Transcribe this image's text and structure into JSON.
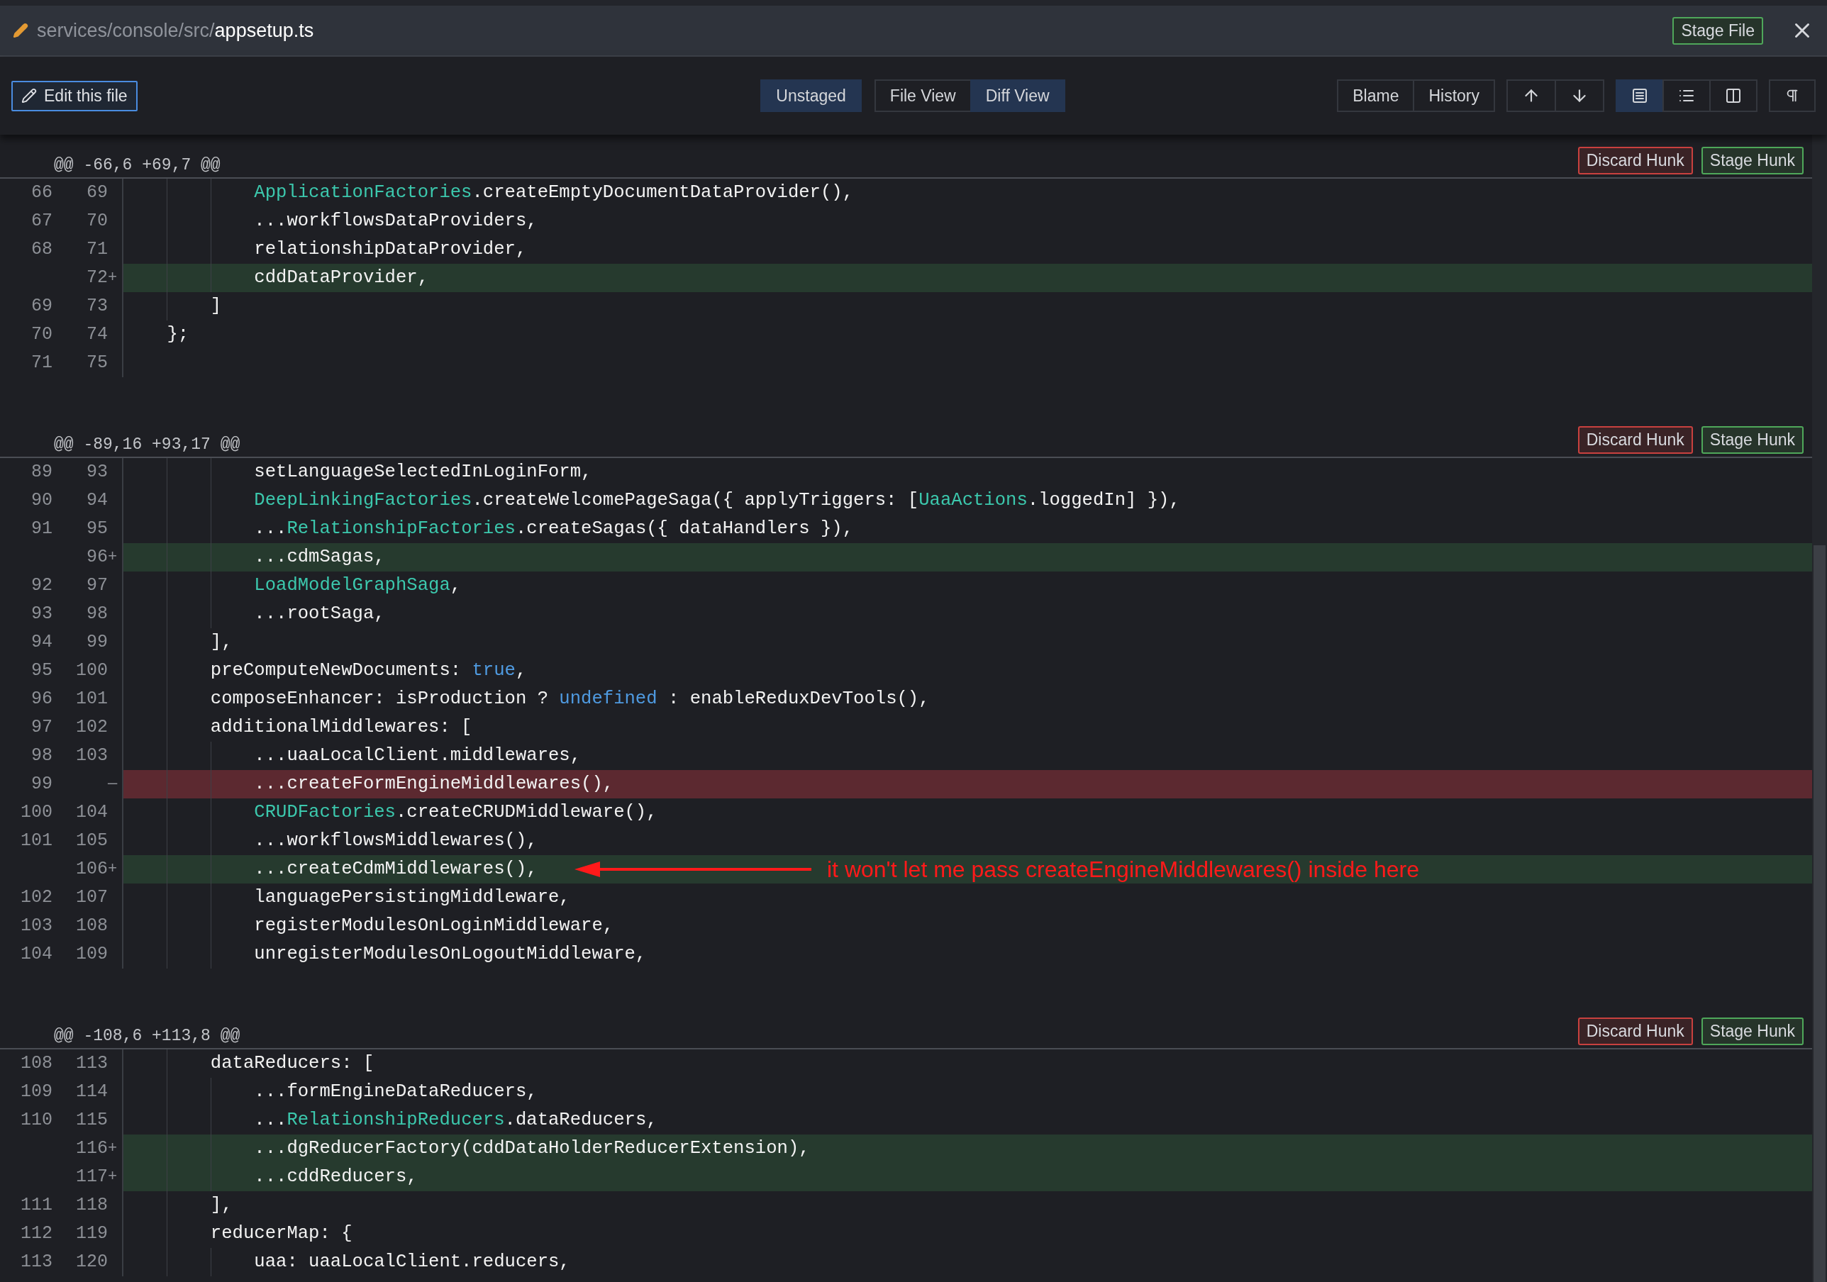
{
  "title_bar": {
    "path": "services/console/src/",
    "file": "appsetup.ts",
    "stage_button": "Stage File"
  },
  "toolbar": {
    "edit_button": "Edit this file",
    "stage_selector": "Unstaged",
    "views": [
      {
        "label": "File View",
        "selected": false
      },
      {
        "label": "Diff View",
        "selected": true
      }
    ],
    "history_buttons": [
      "Blame",
      "History"
    ],
    "layouts": [
      {
        "kind": "unified",
        "selected": true
      },
      {
        "kind": "list",
        "selected": false
      },
      {
        "kind": "split",
        "selected": false
      }
    ]
  },
  "hunks": [
    {
      "header": "@@ -66,6 +69,7 @@",
      "discard_button": "Discard Hunk",
      "stage_button": "Stage Hunk",
      "lines": [
        {
          "old": "66",
          "new": "69",
          "kind": "context",
          "tokens": [
            {
              "text": "            ApplicationFactories",
              "kind": "type"
            },
            {
              "text": ".createEmptyDocumentDataProvider(),"
            }
          ]
        },
        {
          "old": "67",
          "new": "70",
          "kind": "context",
          "tokens": [
            {
              "text": "            ...workflowsDataProviders,"
            }
          ]
        },
        {
          "old": "68",
          "new": "71",
          "kind": "context",
          "tokens": [
            {
              "text": "            relationshipDataProvider,"
            }
          ]
        },
        {
          "new": "72",
          "kind": "add",
          "sign": "+",
          "tokens": [
            {
              "text": "            cddDataProvider,"
            }
          ]
        },
        {
          "old": "69",
          "new": "73",
          "kind": "context",
          "tokens": [
            {
              "text": "        ]"
            }
          ]
        },
        {
          "old": "70",
          "new": "74",
          "kind": "context",
          "tokens": [
            {
              "text": "    };"
            }
          ]
        },
        {
          "old": "71",
          "new": "75",
          "kind": "context"
        }
      ]
    },
    {
      "header": "@@ -89,16 +93,17 @@",
      "discard_button": "Discard Hunk",
      "stage_button": "Stage Hunk",
      "lines": [
        {
          "old": "89",
          "new": "93",
          "kind": "context",
          "tokens": [
            {
              "text": "            setLanguageSelectedInLoginForm,"
            }
          ]
        },
        {
          "old": "90",
          "new": "94",
          "kind": "context",
          "tokens": [
            {
              "text": "            DeepLinkingFactories",
              "kind": "type"
            },
            {
              "text": ".createWelcomePageSaga({ applyTriggers: ["
            },
            {
              "text": "UaaActions",
              "kind": "type"
            },
            {
              "text": ".loggedIn] }),"
            }
          ]
        },
        {
          "old": "91",
          "new": "95",
          "kind": "context",
          "tokens": [
            {
              "text": "            ..."
            },
            {
              "text": "RelationshipFactories",
              "kind": "type"
            },
            {
              "text": ".createSagas({ dataHandlers }),"
            }
          ]
        },
        {
          "new": "96",
          "kind": "add",
          "sign": "+",
          "tokens": [
            {
              "text": "            ...cdmSagas,"
            }
          ]
        },
        {
          "old": "92",
          "new": "97",
          "kind": "context",
          "tokens": [
            {
              "text": "            LoadModelGraphSaga",
              "kind": "type"
            },
            {
              "text": ","
            }
          ]
        },
        {
          "old": "93",
          "new": "98",
          "kind": "context",
          "tokens": [
            {
              "text": "            ...rootSaga,"
            }
          ]
        },
        {
          "old": "94",
          "new": "99",
          "kind": "context",
          "tokens": [
            {
              "text": "        ],"
            }
          ]
        },
        {
          "old": "95",
          "new": "100",
          "kind": "context",
          "tokens": [
            {
              "text": "        preComputeNewDocuments: "
            },
            {
              "text": "true",
              "kind": "keyword"
            },
            {
              "text": ","
            }
          ]
        },
        {
          "old": "96",
          "new": "101",
          "kind": "context",
          "tokens": [
            {
              "text": "        composeEnhancer: isProduction ? "
            },
            {
              "text": "undefined",
              "kind": "keyword"
            },
            {
              "text": " : enableReduxDevTools(),"
            }
          ]
        },
        {
          "old": "97",
          "new": "102",
          "kind": "context",
          "tokens": [
            {
              "text": "        additionalMiddlewares: ["
            }
          ]
        },
        {
          "old": "98",
          "new": "103",
          "kind": "context",
          "tokens": [
            {
              "text": "            ...uaaLocalClient.middlewares,"
            }
          ]
        },
        {
          "old": "99",
          "kind": "del",
          "sign": "—",
          "tokens": [
            {
              "text": "            ...createFormEngineMiddlewares(),"
            }
          ]
        },
        {
          "old": "100",
          "new": "104",
          "kind": "context",
          "tokens": [
            {
              "text": "            CRUDFactories",
              "kind": "type"
            },
            {
              "text": ".createCRUDMiddleware(),"
            }
          ]
        },
        {
          "old": "101",
          "new": "105",
          "kind": "context",
          "tokens": [
            {
              "text": "            ...workflowsMiddlewares(),"
            }
          ]
        },
        {
          "new": "106",
          "kind": "add",
          "sign": "+",
          "tokens": [
            {
              "text": "            ...createCdmMiddlewares(),"
            }
          ],
          "note": "it won't let me pass createEngineMiddlewares() inside here"
        },
        {
          "old": "102",
          "new": "107",
          "kind": "context",
          "tokens": [
            {
              "text": "            languagePersistingMiddleware,"
            }
          ]
        },
        {
          "old": "103",
          "new": "108",
          "kind": "context",
          "tokens": [
            {
              "text": "            registerModulesOnLoginMiddleware,"
            }
          ]
        },
        {
          "old": "104",
          "new": "109",
          "kind": "context",
          "tokens": [
            {
              "text": "            unregisterModulesOnLogoutMiddleware,"
            }
          ]
        }
      ]
    },
    {
      "header": "@@ -108,6 +113,8 @@",
      "discard_button": "Discard Hunk",
      "stage_button": "Stage Hunk",
      "lines": [
        {
          "old": "108",
          "new": "113",
          "kind": "context",
          "tokens": [
            {
              "text": "        dataReducers: ["
            }
          ]
        },
        {
          "old": "109",
          "new": "114",
          "kind": "context",
          "tokens": [
            {
              "text": "            ...formEngineDataReducers,"
            }
          ]
        },
        {
          "old": "110",
          "new": "115",
          "kind": "context",
          "tokens": [
            {
              "text": "            ..."
            },
            {
              "text": "RelationshipReducers",
              "kind": "type"
            },
            {
              "text": ".dataReducers,"
            }
          ]
        },
        {
          "new": "116",
          "kind": "add",
          "sign": "+",
          "tokens": [
            {
              "text": "            ...dgReducerFactory(cddDataHolderReducerExtension),"
            }
          ]
        },
        {
          "new": "117",
          "kind": "add",
          "sign": "+",
          "tokens": [
            {
              "text": "            ...cddReducers,"
            }
          ]
        },
        {
          "old": "111",
          "new": "118",
          "kind": "context",
          "tokens": [
            {
              "text": "        ],"
            }
          ]
        },
        {
          "old": "112",
          "new": "119",
          "kind": "context",
          "tokens": [
            {
              "text": "        reducerMap: {"
            }
          ]
        },
        {
          "old": "113",
          "new": "120",
          "kind": "context",
          "tokens": [
            {
              "text": "            uaa: uaaLocalClient.reducers,"
            }
          ]
        }
      ]
    }
  ]
}
